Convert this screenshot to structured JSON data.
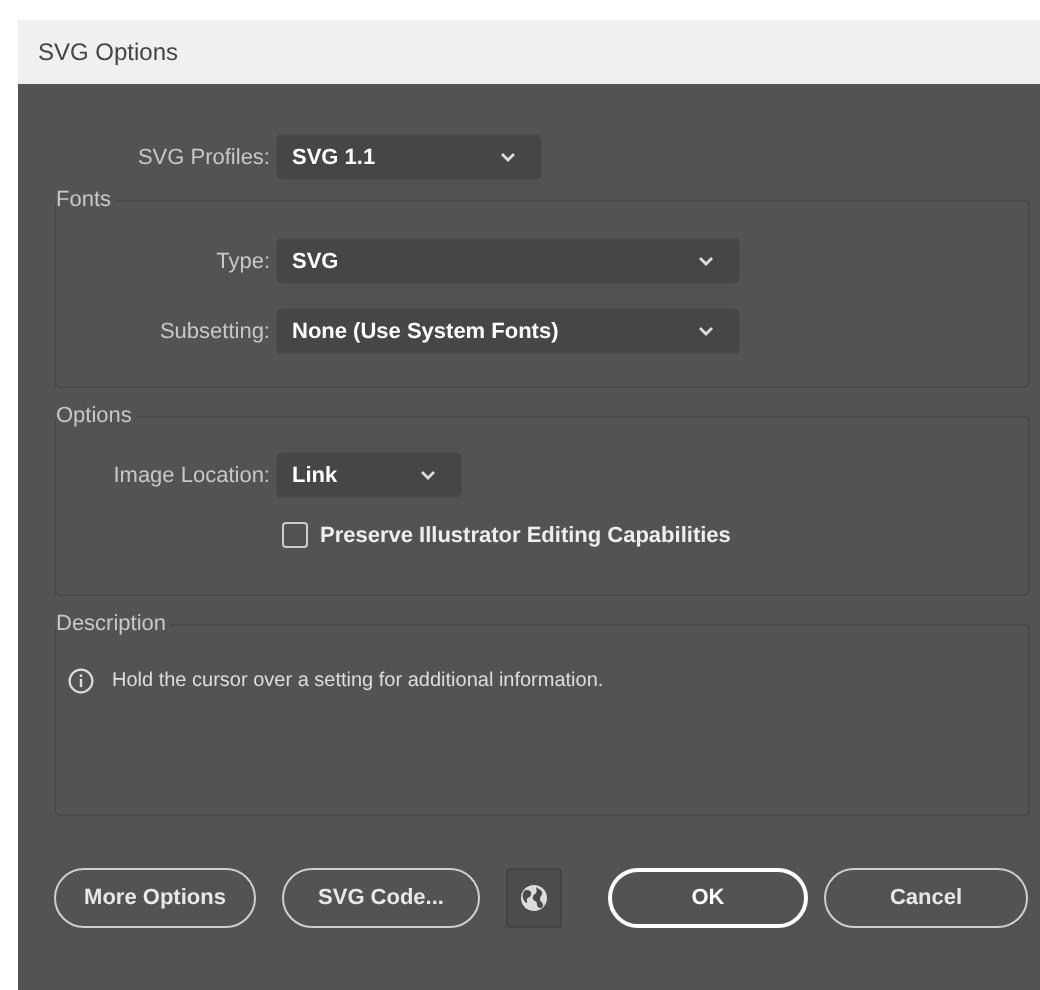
{
  "window": {
    "title": "SVG Options"
  },
  "svg_profiles": {
    "label": "SVG Profiles:",
    "value": "SVG 1.1"
  },
  "fonts": {
    "title": "Fonts",
    "fields": [
      {
        "label": "Type:",
        "value": "SVG"
      },
      {
        "label": "Subsetting:",
        "value": "None (Use System Fonts)"
      }
    ]
  },
  "options": {
    "title": "Options",
    "image_location": {
      "label": "Image Location:",
      "value": "Link"
    },
    "preserve_editing": {
      "label": "Preserve Illustrator Editing Capabilities",
      "checked": false
    }
  },
  "description": {
    "title": "Description",
    "text": "Hold the cursor over a setting for additional information."
  },
  "buttons": [
    {
      "label": "More Options",
      "kind": "secondary"
    },
    {
      "label": "SVG Code...",
      "kind": "secondary"
    },
    {
      "kind": "globe"
    },
    {
      "label": "OK",
      "kind": "primary"
    },
    {
      "label": "Cancel",
      "kind": "secondary"
    }
  ]
}
